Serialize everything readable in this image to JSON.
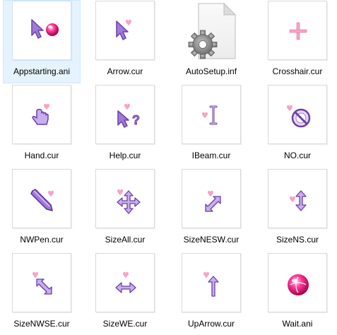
{
  "files": [
    {
      "name": "Appstarting.ani",
      "icon": "appstarting-cursor-icon",
      "selected": true
    },
    {
      "name": "Arrow.cur",
      "icon": "arrow-cursor-icon"
    },
    {
      "name": "AutoSetup.inf",
      "icon": "settings-file-icon"
    },
    {
      "name": "Crosshair.cur",
      "icon": "crosshair-cursor-icon"
    },
    {
      "name": "Hand.cur",
      "icon": "hand-cursor-icon"
    },
    {
      "name": "Help.cur",
      "icon": "help-cursor-icon"
    },
    {
      "name": "IBeam.cur",
      "icon": "ibeam-cursor-icon"
    },
    {
      "name": "NO.cur",
      "icon": "no-cursor-icon"
    },
    {
      "name": "NWPen.cur",
      "icon": "pen-cursor-icon"
    },
    {
      "name": "SizeAll.cur",
      "icon": "move-cursor-icon"
    },
    {
      "name": "SizeNESW.cur",
      "icon": "resize-nesw-cursor-icon"
    },
    {
      "name": "SizeNS.cur",
      "icon": "resize-ns-cursor-icon"
    },
    {
      "name": "SizeNWSE.cur",
      "icon": "resize-nwse-cursor-icon"
    },
    {
      "name": "SizeWE.cur",
      "icon": "resize-we-cursor-icon"
    },
    {
      "name": "UpArrow.cur",
      "icon": "up-arrow-cursor-icon"
    },
    {
      "name": "Wait.ani",
      "icon": "wait-cursor-icon"
    }
  ],
  "colors": {
    "selection_bg": "#e5f3ff",
    "selection_border": "#cce8ff",
    "cursor_purple": "#9966cc",
    "cursor_purple_light": "#d8c4f0",
    "heart_pink": "#f7a3c6",
    "ball_pink": "#e8006e"
  }
}
